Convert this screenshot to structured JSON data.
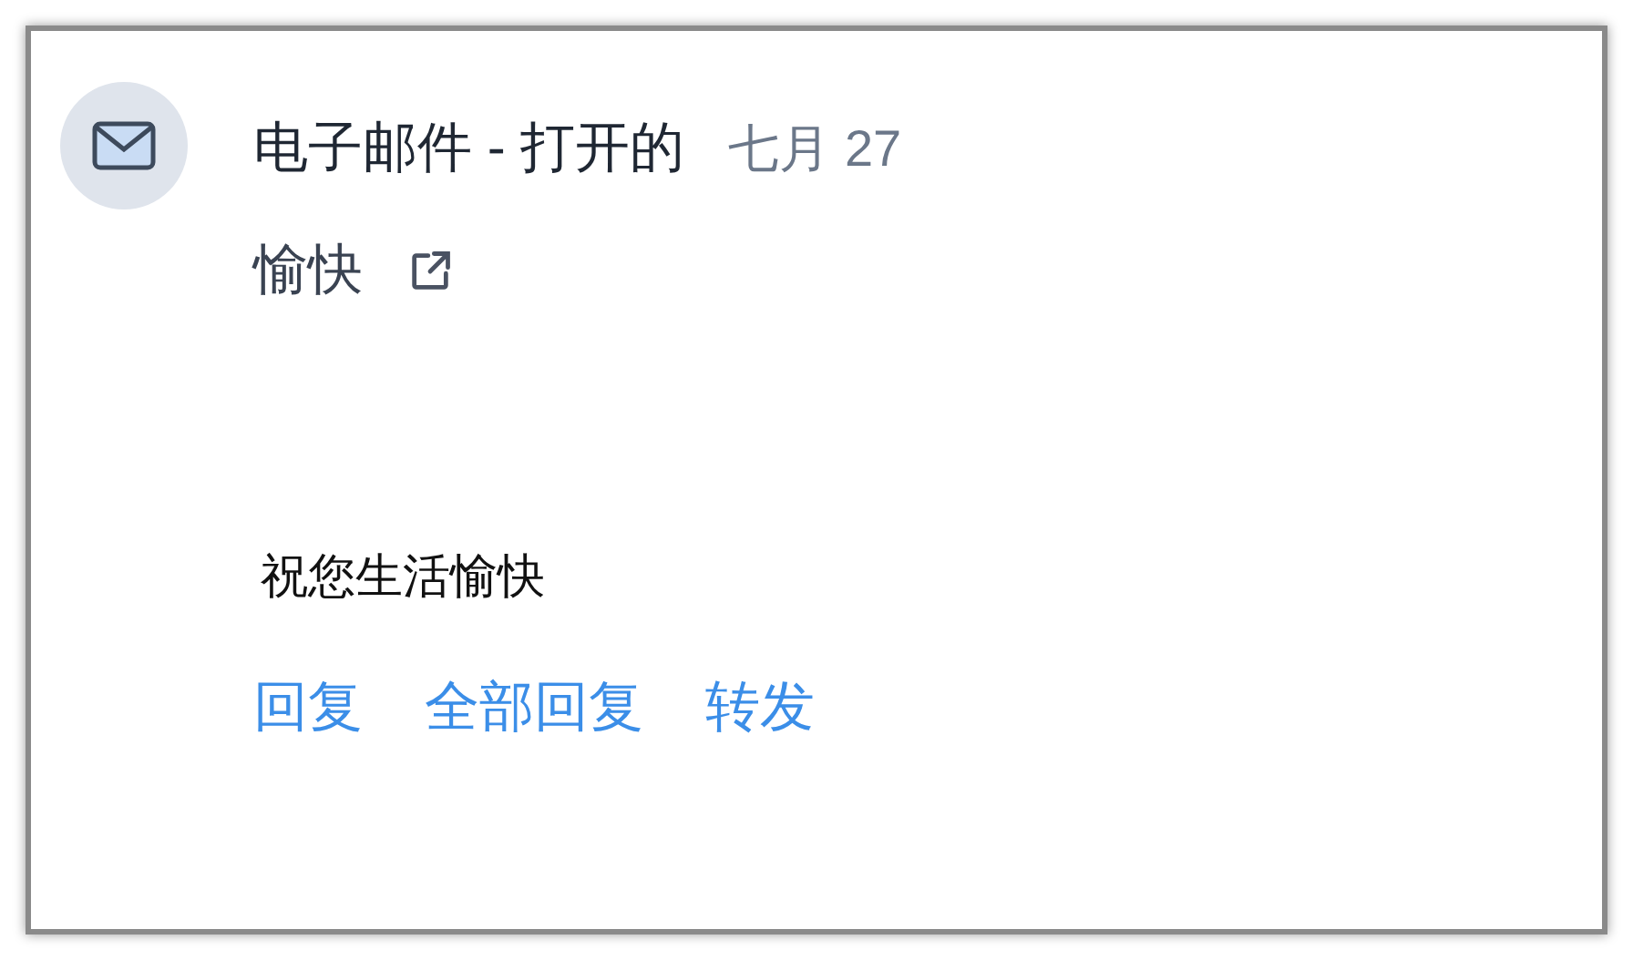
{
  "title": "电子邮件 - 打开的",
  "date": "七月 27",
  "subject": "愉快",
  "body": "祝您生活愉快",
  "actions": [
    "回复",
    "全部回复",
    "转发"
  ]
}
